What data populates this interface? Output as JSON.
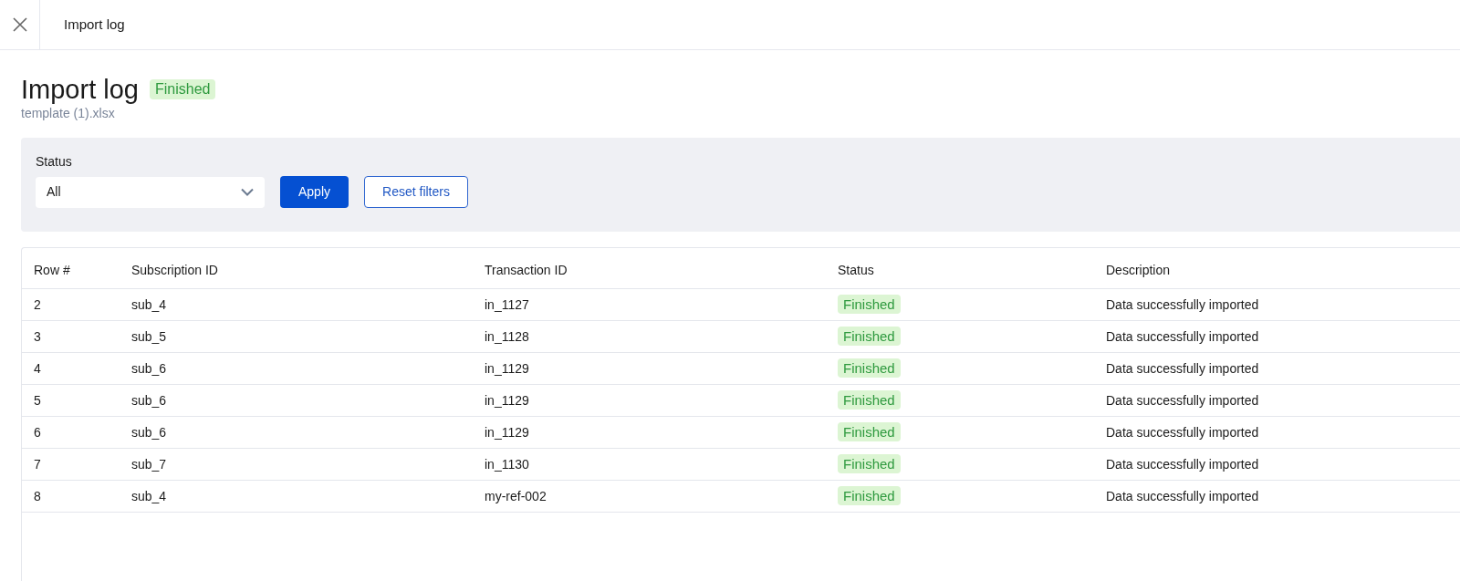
{
  "header": {
    "title": "Import log"
  },
  "page": {
    "title": "Import log",
    "status": {
      "label": "Finished",
      "kind": "success"
    },
    "file": "template (1).xlsx"
  },
  "filters": {
    "status_label": "Status",
    "status_value": "All",
    "apply": "Apply",
    "reset": "Reset filters"
  },
  "table": {
    "columns": [
      "Row #",
      "Subscription ID",
      "Transaction ID",
      "Status",
      "Description"
    ],
    "rows": [
      {
        "row": "2",
        "subscription": "sub_4",
        "transaction": "in_1127",
        "status": {
          "label": "Finished",
          "kind": "success"
        },
        "description": "Data successfully imported"
      },
      {
        "row": "3",
        "subscription": "sub_5",
        "transaction": "in_1128",
        "status": {
          "label": "Finished",
          "kind": "success"
        },
        "description": "Data successfully imported"
      },
      {
        "row": "4",
        "subscription": "sub_6",
        "transaction": "in_1129",
        "status": {
          "label": "Finished",
          "kind": "success"
        },
        "description": "Data successfully imported"
      },
      {
        "row": "5",
        "subscription": "sub_6",
        "transaction": "in_1129",
        "status": {
          "label": "Finished",
          "kind": "success"
        },
        "description": "Data successfully imported"
      },
      {
        "row": "6",
        "subscription": "sub_6",
        "transaction": "in_1129",
        "status": {
          "label": "Finished",
          "kind": "success"
        },
        "description": "Data successfully imported"
      },
      {
        "row": "7",
        "subscription": "sub_7",
        "transaction": "in_1130",
        "status": {
          "label": "Finished",
          "kind": "success"
        },
        "description": "Data successfully imported"
      },
      {
        "row": "8",
        "subscription": "sub_4",
        "transaction": "my-ref-002",
        "status": {
          "label": "Finished",
          "kind": "success"
        },
        "description": "Data successfully imported"
      }
    ]
  }
}
